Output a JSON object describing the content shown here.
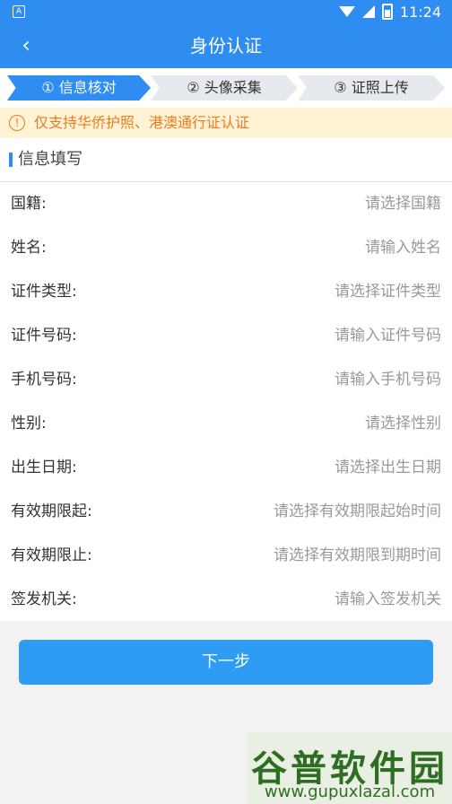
{
  "status": {
    "time": "11:24",
    "left_icon": "A"
  },
  "header": {
    "title": "身份认证",
    "back_symbol": "‹"
  },
  "steps": [
    {
      "label": "① 信息核对",
      "active": true
    },
    {
      "label": "② 头像采集",
      "active": false
    },
    {
      "label": "③ 证照上传",
      "active": false
    }
  ],
  "notice": {
    "icon": "!",
    "text": "仅支持华侨护照、港澳通行证认证"
  },
  "section": {
    "title": "信息填写"
  },
  "form": {
    "rows": [
      {
        "label": "国籍:",
        "placeholder": "请选择国籍"
      },
      {
        "label": "姓名:",
        "placeholder": "请输入姓名"
      },
      {
        "label": "证件类型:",
        "placeholder": "请选择证件类型"
      },
      {
        "label": "证件号码:",
        "placeholder": "请输入证件号码"
      },
      {
        "label": "手机号码:",
        "placeholder": "请输入手机号码"
      },
      {
        "label": "性别:",
        "placeholder": "请选择性别"
      },
      {
        "label": "出生日期:",
        "placeholder": "请选择出生日期"
      },
      {
        "label": "有效期限起:",
        "placeholder": "请选择有效期限起始时间"
      },
      {
        "label": "有效期限止:",
        "placeholder": "请选择有效期限到期时间"
      },
      {
        "label": "签发机关:",
        "placeholder": "请输入签发机关"
      }
    ]
  },
  "actions": {
    "next_label": "下一步"
  },
  "watermark": {
    "title": "谷普软件园",
    "url": "www.gupuxlazal.com"
  }
}
